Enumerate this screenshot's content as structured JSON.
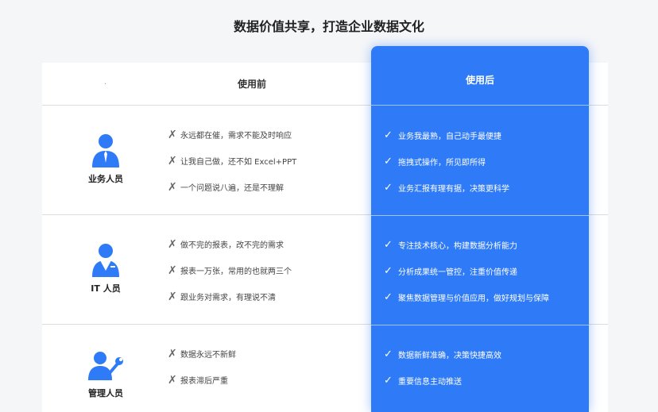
{
  "page": {
    "title": "数据价值共享，打造企业数据文化"
  },
  "header": {
    "dot": "·",
    "before": "使用前",
    "after": "使用后"
  },
  "marks": {
    "cross": "✗",
    "check": "✓"
  },
  "rows": [
    {
      "role": "业务人员",
      "icon": "business-person-icon",
      "before": [
        "永远都在催，需求不能及时响应",
        "让我自己做，还不如 Excel+PPT",
        "一个问题说八遍，还是不理解"
      ],
      "after": [
        "业务我最熟，自己动手最便捷",
        "拖拽式操作，所见即所得",
        "业务汇报有理有据，决策更科学"
      ]
    },
    {
      "role": "IT 人员",
      "icon": "it-person-icon",
      "before": [
        "做不完的报表，改不完的需求",
        "报表一万张，常用的也就两三个",
        "跟业务对需求，有理说不清"
      ],
      "after": [
        "专注技术核心，构建数据分析能力",
        "分析成果统一管控，注重价值传递",
        "聚焦数据管理与价值应用，做好规划与保障"
      ]
    },
    {
      "role": "管理人员",
      "icon": "manager-wrench-icon",
      "before": [
        "数据永远不新鲜",
        "报表滞后严重"
      ],
      "after": [
        "数据新鲜准确，决策快捷高效",
        "重要信息主动推送"
      ]
    }
  ],
  "colors": {
    "accent": "#2f7bf7",
    "background": "#f5f6f8"
  }
}
